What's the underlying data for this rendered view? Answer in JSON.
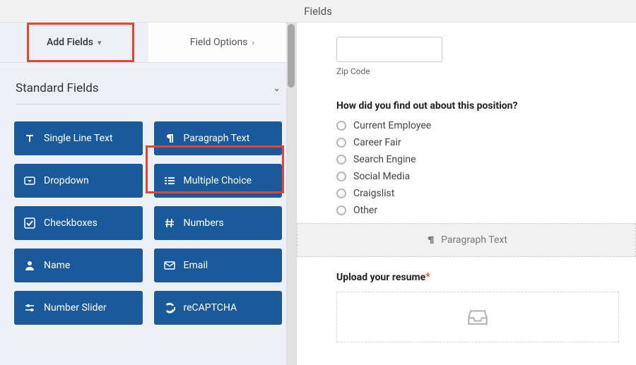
{
  "header": {
    "title": "Fields"
  },
  "tabs": {
    "add": "Add Fields",
    "options": "Field Options"
  },
  "section": {
    "standard": "Standard Fields"
  },
  "fields": {
    "single_line": "Single Line Text",
    "paragraph": "Paragraph Text",
    "dropdown": "Dropdown",
    "multiple_choice": "Multiple Choice",
    "checkboxes": "Checkboxes",
    "numbers": "Numbers",
    "name": "Name",
    "email": "Email",
    "number_slider": "Number Slider",
    "recaptcha": "reCAPTCHA"
  },
  "preview": {
    "zip_label": "Zip Code",
    "question": "How did you find out about this position?",
    "options": {
      "o1": "Current Employee",
      "o2": "Career Fair",
      "o3": "Search Engine",
      "o4": "Social Media",
      "o5": "Craigslist",
      "o6": "Other"
    },
    "drop_label": "Paragraph Text",
    "upload_label": "Upload your resume",
    "required": "*"
  },
  "colors": {
    "accent": "#1a5a9a",
    "highlight": "#e8432e"
  }
}
